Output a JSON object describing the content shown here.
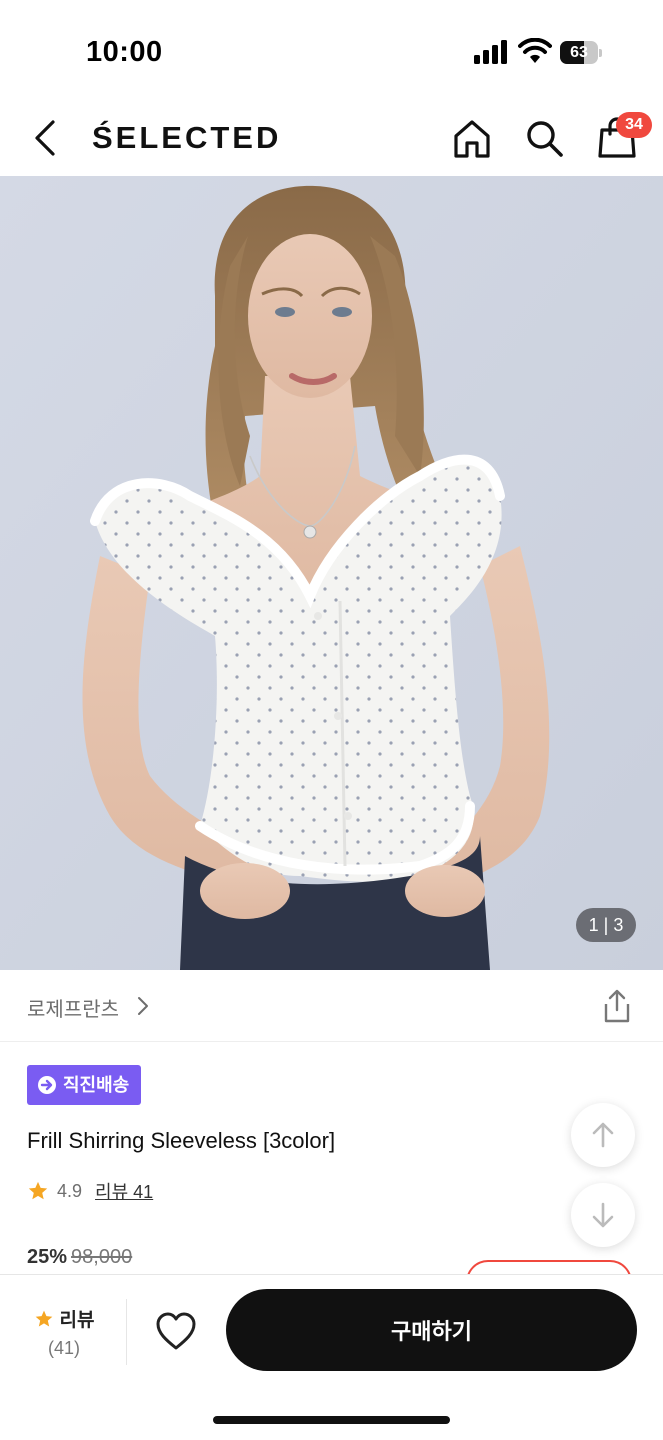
{
  "status_bar": {
    "time": "10:00",
    "battery": "63",
    "battery_level": 0.63
  },
  "header": {
    "brand": "ŚELECTED",
    "cart_count": "34"
  },
  "hero": {
    "image_counter": "1 | 3",
    "background": "#d6dbe6"
  },
  "brand_row": {
    "brand_name": "로제프란츠"
  },
  "product": {
    "tag": "직진배송",
    "tag_color": "#7a5cf2",
    "title": "Frill Shirring Sleeveless [3color]",
    "rating": "4.9",
    "review_link": "리뷰 41",
    "discount": "25%",
    "original_price": "98,000"
  },
  "bottom_bar": {
    "review_label": "리뷰",
    "review_count": "(41)",
    "buy_label": "구매하기"
  },
  "colors": {
    "accent_red": "#f0483e",
    "star": "#f5a623",
    "dark": "#111111"
  },
  "icons": [
    "back-icon",
    "home-icon",
    "search-icon",
    "shopping-bag-icon",
    "chevron-right-icon",
    "share-icon",
    "arrow-up-icon",
    "arrow-down-icon",
    "star-icon",
    "heart-icon",
    "signal-icon",
    "wifi-icon",
    "battery-icon"
  ]
}
